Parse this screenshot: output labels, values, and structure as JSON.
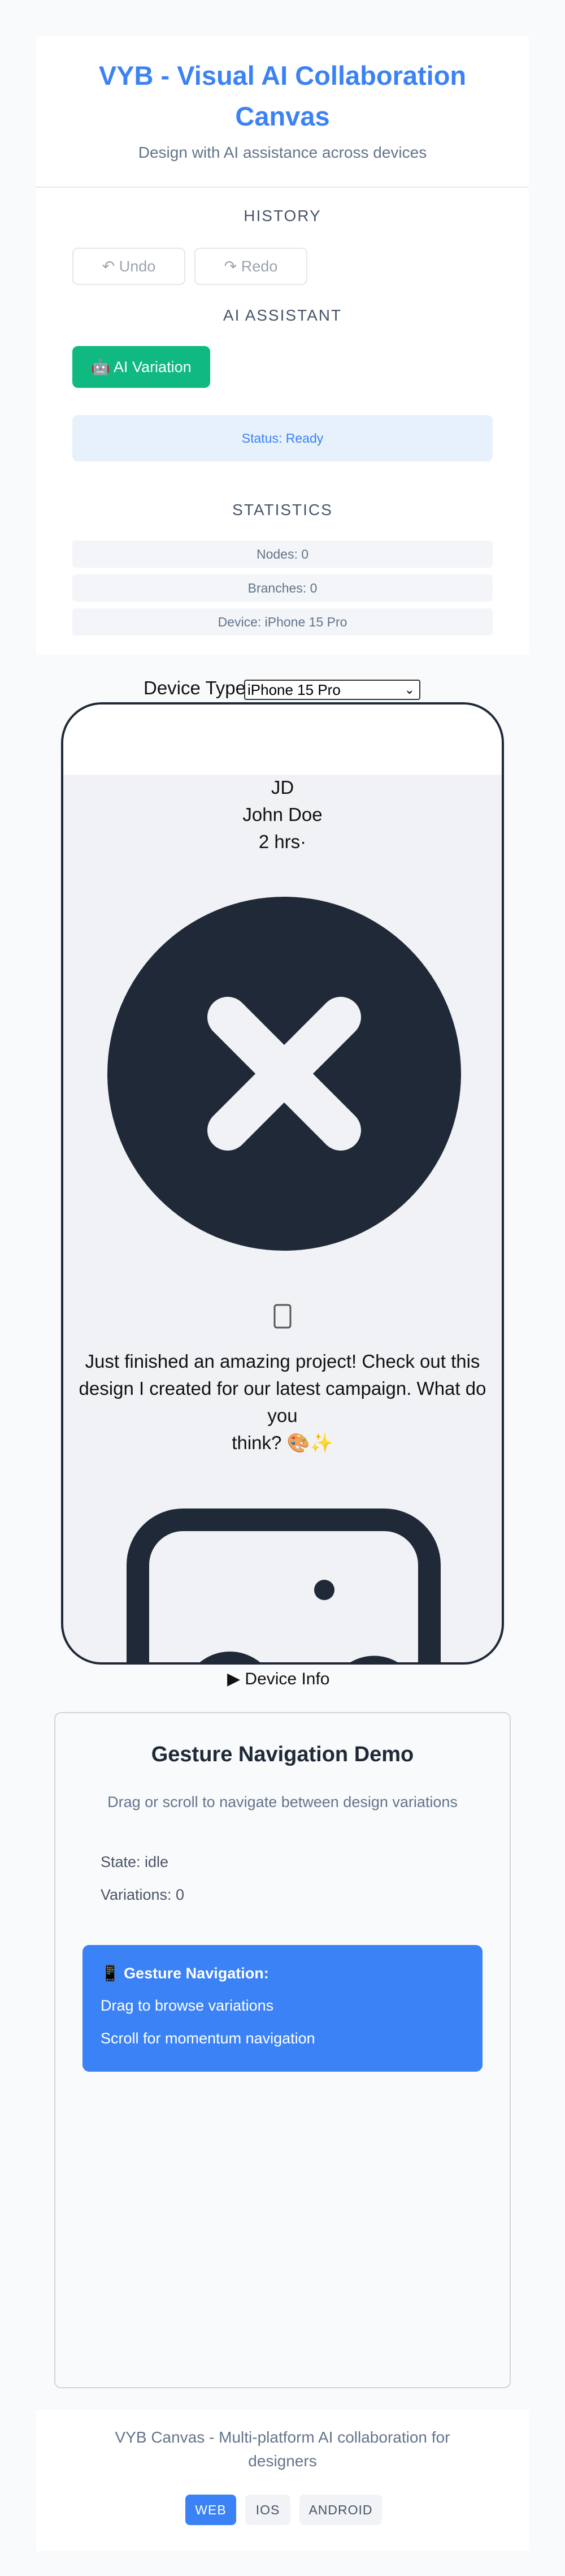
{
  "header": {
    "title_line1": "VYB - Visual AI Collaboration",
    "title_line2": "Canvas",
    "subtitle": "Design with AI assistance across devices"
  },
  "history": {
    "label": "HISTORY",
    "undo_icon": "↶",
    "undo_label": "Undo",
    "redo_icon": "↷",
    "redo_label": "Redo"
  },
  "ai_assistant": {
    "label": "AI ASSISTANT",
    "variation_icon": "🤖",
    "variation_label": "AI Variation",
    "status": "Status: Ready"
  },
  "statistics": {
    "label": "STATISTICS",
    "nodes": "Nodes: 0",
    "branches": "Branches: 0",
    "device": "Device: iPhone 15 Pro"
  },
  "device_selector": {
    "label": "Device Type",
    "selected": "iPhone 15 Pro"
  },
  "post": {
    "initials": "JD",
    "author": "John Doe",
    "time": "2 hrs·",
    "body_line1": "Just finished an amazing project! Check out this",
    "body_line2": "design I created for our latest campaign. What do you",
    "body_line3": "think? 🎨✨",
    "avatar_icon": "close-circle-icon",
    "image_icon": "image-icon"
  },
  "device_info": {
    "label": "▶ Device Info"
  },
  "gesture_demo": {
    "title": "Gesture Navigation Demo",
    "description": "Drag or scroll to navigate between design variations",
    "state": "State: idle",
    "variations": "Variations: 0",
    "box_icon": "📱",
    "box_title": "Gesture Navigation:",
    "box_line1": "Drag to browse variations",
    "box_line2": "Scroll for momentum navigation"
  },
  "footer": {
    "text_line1": "VYB Canvas - Multi-platform AI collaboration for",
    "text_line2": "designers",
    "platforms": [
      "WEB",
      "IOS",
      "ANDROID"
    ]
  },
  "colors": {
    "accent": "#3b82f6",
    "success": "#10b981",
    "dark": "#1f2937",
    "muted": "#64748b"
  }
}
